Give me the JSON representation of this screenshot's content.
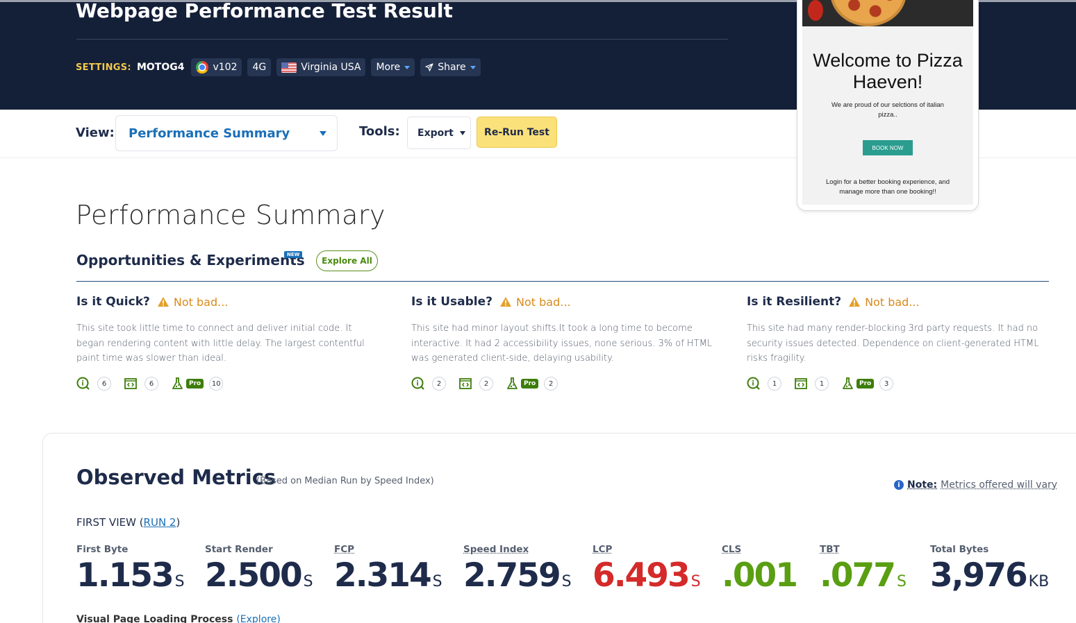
{
  "header": {
    "title": "Webpage Performance Test Result",
    "settings_label": "SETTINGS:",
    "device": "MOTOG4",
    "browser_version": "v102",
    "connection": "4G",
    "location": "Virginia USA",
    "more_label": "More",
    "share_label": "Share"
  },
  "preview": {
    "welcome": "Welcome to Pizza Haeven!",
    "tagline": "We are proud of our selctions of italian pizza..",
    "book_button": "BOOK NOW",
    "login_text": "Login for a better booking experience, and manage more than one booking!!"
  },
  "viewbar": {
    "view_label": "View:",
    "view_value": "Performance Summary",
    "tools_label": "Tools:",
    "export_label": "Export",
    "rerun_label": "Re-Run Test"
  },
  "summary": {
    "title": "Performance Summary",
    "opportunities_title": "Opportunities & Experiments",
    "new_badge": "NEW",
    "explore_all": "Explore All",
    "columns": [
      {
        "heading": "Is it Quick?",
        "verdict": "Not bad...",
        "text": "This site took little time to connect and deliver initial code. It began rendering content with little delay. The largest contentful paint time was slower than ideal.",
        "counts": [
          "6",
          "6",
          "10"
        ]
      },
      {
        "heading": "Is it Usable?",
        "verdict": "Not bad...",
        "text": "This site had minor layout shifts.It took a long time to become interactive. It had 2 accessibility issues, none serious. 3% of HTML was generated client-side, delaying usability.",
        "counts": [
          "2",
          "2",
          "2"
        ]
      },
      {
        "heading": "Is it Resilient?",
        "verdict": "Not bad...",
        "text": "This site had many render-blocking 3rd party requests. It had no security issues detected. Dependence on client-generated HTML risks fragility.",
        "counts": [
          "1",
          "1",
          "3"
        ]
      }
    ],
    "pro_label": "Pro"
  },
  "metrics": {
    "title": "Observed Metrics",
    "subtitle": "(Based on Median Run by Speed Index)",
    "note_label": "Note:",
    "note_text": "Metrics offered will vary",
    "first_view": "FIRST VIEW (",
    "run_link": "RUN 2",
    "first_view_close": ")",
    "items": [
      {
        "label": "First Byte",
        "value": "1.153",
        "unit": "S",
        "color": "#1e2b4a"
      },
      {
        "label": "Start Render",
        "value": "2.500",
        "unit": "S",
        "color": "#1e2b4a"
      },
      {
        "label": "FCP",
        "value": "2.314",
        "unit": "S",
        "color": "#1e2b4a"
      },
      {
        "label": "Speed Index",
        "value": "2.759",
        "unit": "S",
        "color": "#1e2b4a"
      },
      {
        "label": "LCP",
        "value": "6.493",
        "unit": "S",
        "color": "#d42a2a"
      },
      {
        "label": "CLS",
        "value": ".001",
        "unit": "",
        "color": "#5a9e12"
      },
      {
        "label": "TBT",
        "value": ".077",
        "unit": "S",
        "color": "#5a9e12"
      },
      {
        "label": "Total Bytes",
        "value": "3,976",
        "unit": "KB",
        "color": "#1e2b4a"
      }
    ],
    "vplp_label": "Visual Page Loading Process",
    "vplp_link": "(Explore)"
  }
}
